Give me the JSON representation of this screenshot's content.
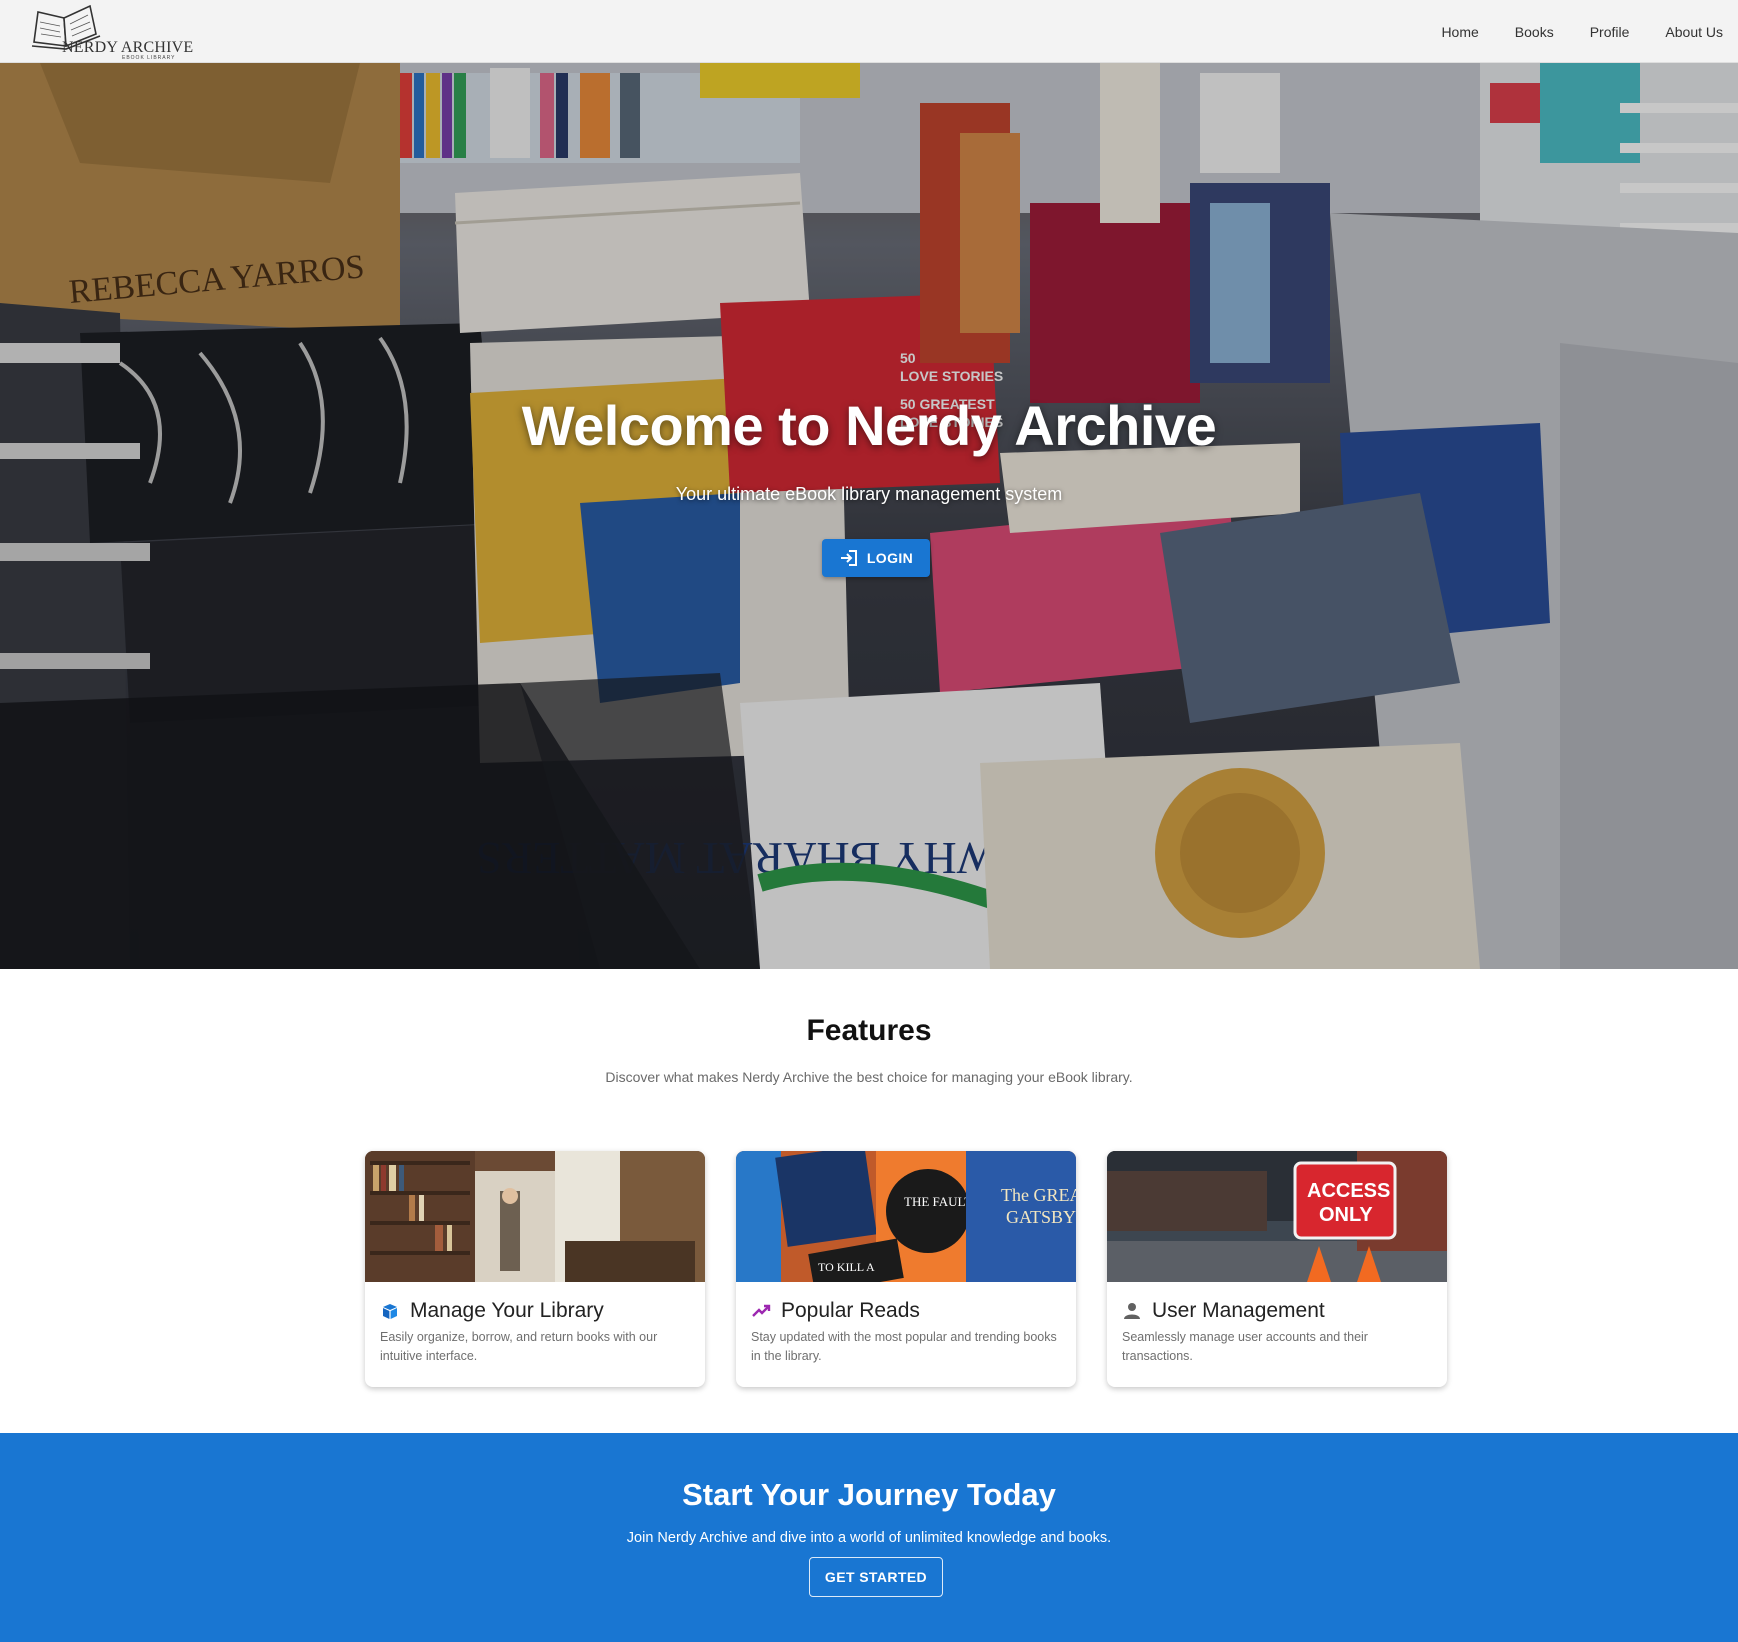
{
  "brand": {
    "title": "NERDY ARCHIVE",
    "subtitle": "EBOOK LIBRARY"
  },
  "nav": {
    "items": [
      {
        "label": "Home"
      },
      {
        "label": "Books"
      },
      {
        "label": "Profile"
      },
      {
        "label": "About Us"
      }
    ]
  },
  "hero": {
    "title": "Welcome to Nerdy Archive",
    "subtitle": "Your ultimate eBook library management system",
    "login_label": "LOGIN",
    "login_icon": "login-icon"
  },
  "features": {
    "title": "Features",
    "subtitle": "Discover what makes Nerdy Archive the best choice for managing your eBook library.",
    "cards": [
      {
        "icon": "book-stack-icon",
        "icon_color": "#1976d2",
        "title": "Manage Your Library",
        "desc": "Easily organize, borrow, and return books with our intuitive interface."
      },
      {
        "icon": "trending-up-icon",
        "icon_color": "#9c27b0",
        "title": "Popular Reads",
        "desc": "Stay updated with the most popular and trending books in the library."
      },
      {
        "icon": "person-icon",
        "icon_color": "#616161",
        "title": "User Management",
        "desc": "Seamlessly manage user accounts and their transactions."
      }
    ]
  },
  "cta": {
    "title": "Start Your Journey Today",
    "subtitle": "Join Nerdy Archive and dive into a world of unlimited knowledge and books.",
    "button_label": "GET STARTED"
  },
  "colors": {
    "primary": "#1976d2",
    "nav_bg": "#f3f3f3"
  }
}
